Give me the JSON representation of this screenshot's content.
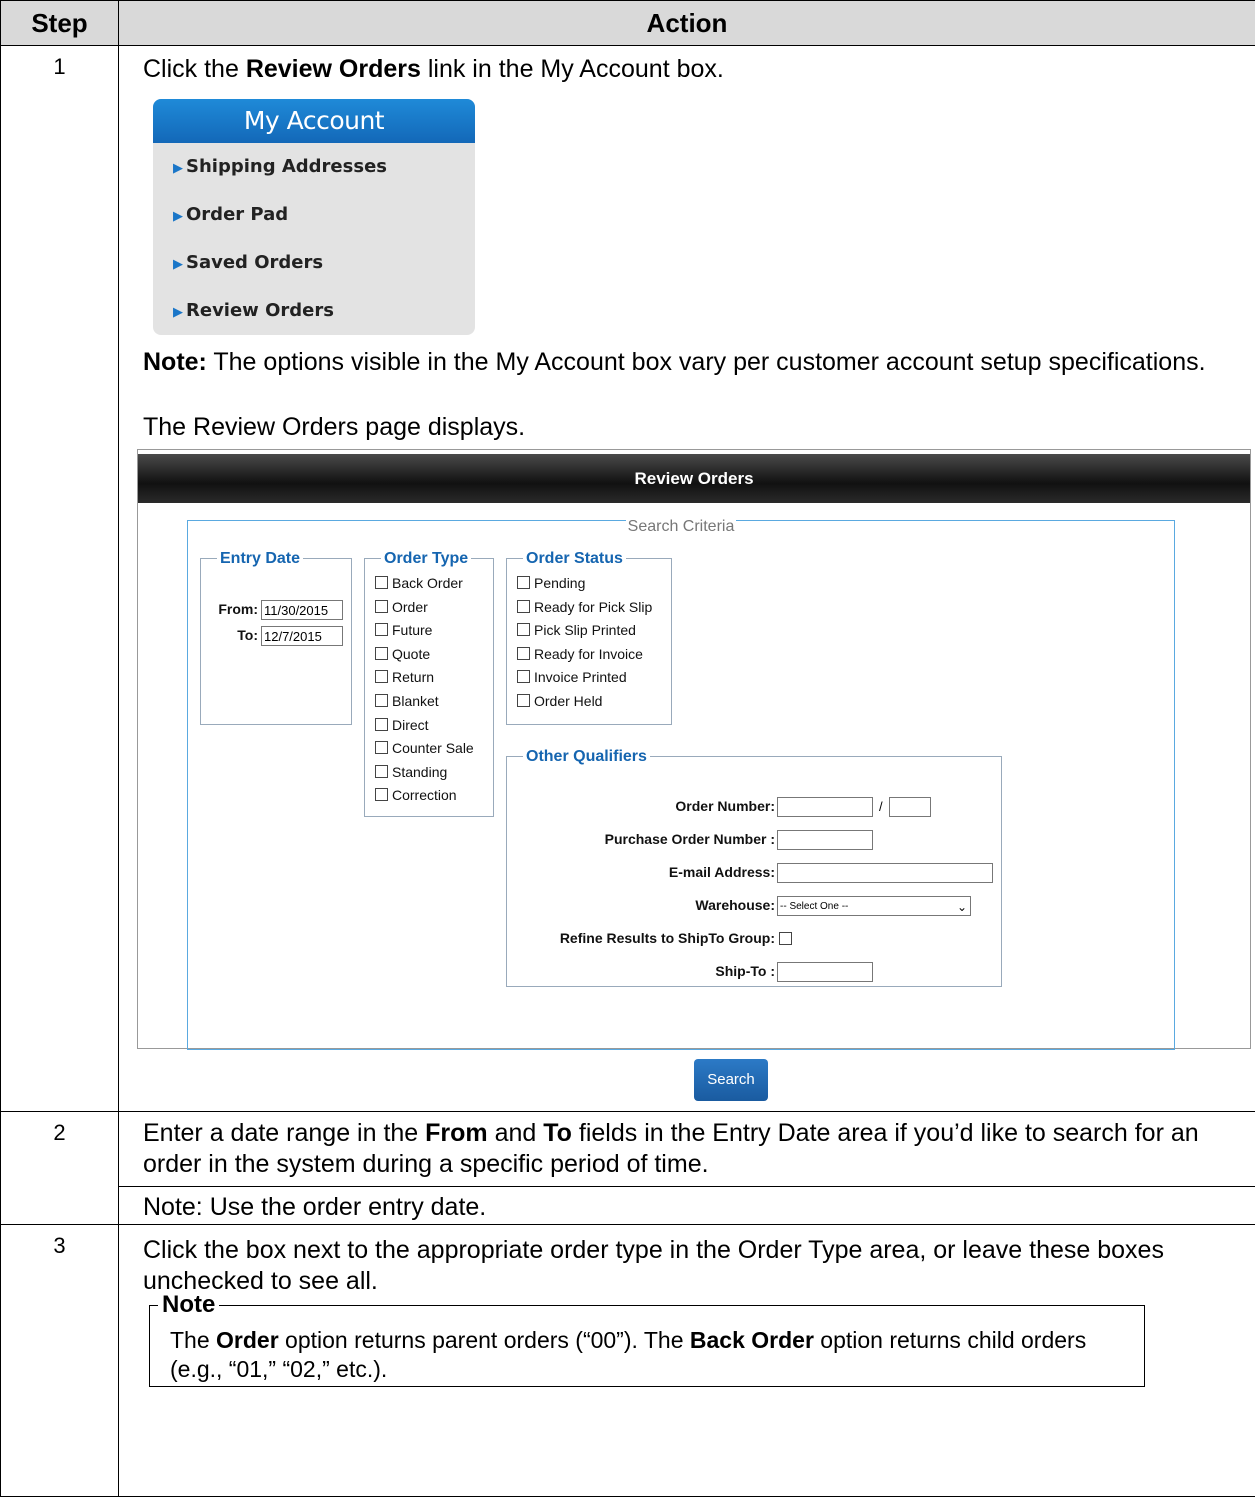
{
  "header": {
    "step": "Step",
    "action": "Action"
  },
  "step1": {
    "num": "1",
    "click_pre": "Click the ",
    "click_bold": "Review Orders",
    "click_post": " link in the My Account box.",
    "my_account": {
      "title": "My Account",
      "items": [
        "Shipping Addresses",
        "Order Pad",
        "Saved Orders",
        "Review Orders"
      ]
    },
    "note_label": "Note:",
    "note_text": " The options visible in the My Account box vary per customer account setup specifications.",
    "displays": "The Review Orders page displays.",
    "review": {
      "title": "Review Orders",
      "search_criteria": "Search Criteria",
      "entry_date": {
        "legend": "Entry Date",
        "from_label": "From:",
        "from_value": "11/30/2015",
        "to_label": "To:",
        "to_value": "12/7/2015"
      },
      "order_type": {
        "legend": "Order Type",
        "options": [
          "Back Order",
          "Order",
          "Future",
          "Quote",
          "Return",
          "Blanket",
          "Direct",
          "Counter Sale",
          "Standing",
          "Correction"
        ]
      },
      "order_status": {
        "legend": "Order Status",
        "options": [
          "Pending",
          "Ready for Pick Slip",
          "Pick Slip Printed",
          "Ready for Invoice",
          "Invoice Printed",
          "Order Held"
        ]
      },
      "other": {
        "legend": "Other Qualifiers",
        "order_number": "Order Number:",
        "slash": "/",
        "po_number": "Purchase Order Number :",
        "email": "E-mail Address:",
        "warehouse": "Warehouse:",
        "warehouse_value": "-- Select One --",
        "refine": "Refine Results to ShipTo Group:",
        "ship_to": "Ship-To :"
      },
      "search_button": "Search"
    }
  },
  "step2": {
    "num": "2",
    "t1": "Enter a date range in the ",
    "b1": "From",
    "t2": " and ",
    "b2": "To",
    "t3": " fields in the Entry Date area if you’d like to search for an order in the system during a specific period of time.",
    "note": "Note: Use the order entry date."
  },
  "step3": {
    "num": "3",
    "text": "Click the box next to the appropriate order type in the Order Type area, or leave these boxes unchecked to see all.",
    "note_title": "Note",
    "n1": "The ",
    "nb1": "Order",
    "n2": " option returns parent orders (“00”). The ",
    "nb2": "Back Order",
    "n3": " option returns child orders (e.g., “01,” “02,” etc.)."
  }
}
